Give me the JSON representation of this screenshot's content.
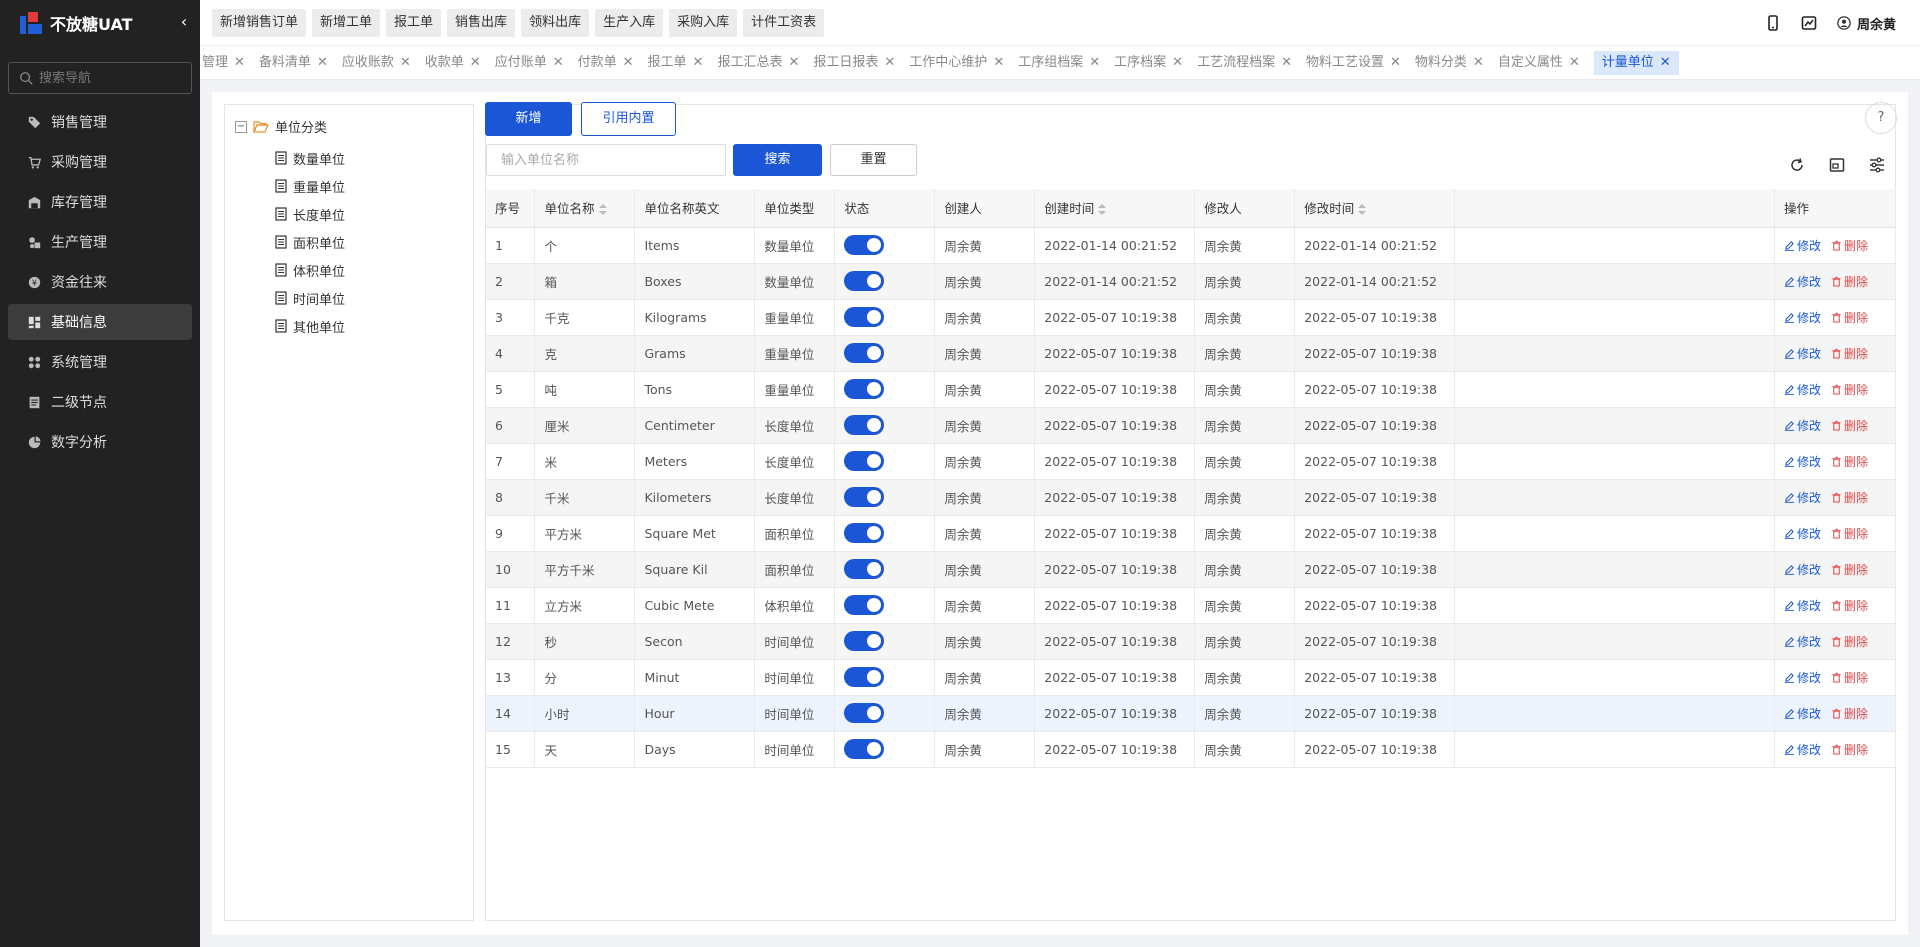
{
  "app": {
    "title": "不放糖UAT"
  },
  "sidebar": {
    "search_placeholder": "搜索导航",
    "items": [
      {
        "label": "销售管理",
        "icon": "tag-icon"
      },
      {
        "label": "采购管理",
        "icon": "cart-icon"
      },
      {
        "label": "库存管理",
        "icon": "warehouse-icon"
      },
      {
        "label": "生产管理",
        "icon": "factory-icon"
      },
      {
        "label": "资金往来",
        "icon": "money-icon"
      },
      {
        "label": "基础信息",
        "icon": "dashboard-icon"
      },
      {
        "label": "系统管理",
        "icon": "apps-icon"
      },
      {
        "label": "二级节点",
        "icon": "list-icon"
      },
      {
        "label": "数字分析",
        "icon": "pie-icon"
      }
    ]
  },
  "topbar": {
    "quick_actions": [
      "新增销售订单",
      "新增工单",
      "报工单",
      "销售出库",
      "领料出库",
      "生产入库",
      "采购入库",
      "计件工资表"
    ],
    "user_name": "周余黄"
  },
  "tabs": [
    "管理",
    "备料清单",
    "应收账款",
    "收款单",
    "应付账单",
    "付款单",
    "报工单",
    "报工汇总表",
    "报工日报表",
    "工作中心维护",
    "工序组档案",
    "工序档案",
    "工艺流程档案",
    "物料工艺设置",
    "物料分类",
    "自定义属性",
    "计量单位"
  ],
  "tree": {
    "root": "单位分类",
    "children": [
      "数量单位",
      "重量单位",
      "长度单位",
      "面积单位",
      "体积单位",
      "时间单位",
      "其他单位"
    ]
  },
  "toolbar": {
    "add_label": "新增",
    "import_label": "引用内置",
    "search_placeholder": "输入单位名称",
    "search_label": "搜索",
    "reset_label": "重置",
    "help_label": "?"
  },
  "table": {
    "headers": [
      "序号",
      "单位名称",
      "单位名称英文",
      "单位类型",
      "状态",
      "创建人",
      "创建时间",
      "修改人",
      "修改时间",
      "",
      "操作"
    ],
    "edit_label": "修改",
    "delete_label": "删除",
    "rows": [
      [
        "1",
        "个",
        "Items",
        "数量单位",
        "周余黄",
        "2022-01-14 00:21:52",
        "周余黄",
        "2022-01-14 00:21:52"
      ],
      [
        "2",
        "箱",
        "Boxes",
        "数量单位",
        "周余黄",
        "2022-01-14 00:21:52",
        "周余黄",
        "2022-01-14 00:21:52"
      ],
      [
        "3",
        "千克",
        "Kilograms",
        "重量单位",
        "周余黄",
        "2022-05-07 10:19:38",
        "周余黄",
        "2022-05-07 10:19:38"
      ],
      [
        "4",
        "克",
        "Grams",
        "重量单位",
        "周余黄",
        "2022-05-07 10:19:38",
        "周余黄",
        "2022-05-07 10:19:38"
      ],
      [
        "5",
        "吨",
        "Tons",
        "重量单位",
        "周余黄",
        "2022-05-07 10:19:38",
        "周余黄",
        "2022-05-07 10:19:38"
      ],
      [
        "6",
        "厘米",
        "Centimeter",
        "长度单位",
        "周余黄",
        "2022-05-07 10:19:38",
        "周余黄",
        "2022-05-07 10:19:38"
      ],
      [
        "7",
        "米",
        "Meters",
        "长度单位",
        "周余黄",
        "2022-05-07 10:19:38",
        "周余黄",
        "2022-05-07 10:19:38"
      ],
      [
        "8",
        "千米",
        "Kilometers",
        "长度单位",
        "周余黄",
        "2022-05-07 10:19:38",
        "周余黄",
        "2022-05-07 10:19:38"
      ],
      [
        "9",
        "平方米",
        "Square Met",
        "面积单位",
        "周余黄",
        "2022-05-07 10:19:38",
        "周余黄",
        "2022-05-07 10:19:38"
      ],
      [
        "10",
        "平方千米",
        "Square Kil",
        "面积单位",
        "周余黄",
        "2022-05-07 10:19:38",
        "周余黄",
        "2022-05-07 10:19:38"
      ],
      [
        "11",
        "立方米",
        "Cubic Mete",
        "体积单位",
        "周余黄",
        "2022-05-07 10:19:38",
        "周余黄",
        "2022-05-07 10:19:38"
      ],
      [
        "12",
        "秒",
        "Secon",
        "时间单位",
        "周余黄",
        "2022-05-07 10:19:38",
        "周余黄",
        "2022-05-07 10:19:38"
      ],
      [
        "13",
        "分",
        "Minut",
        "时间单位",
        "周余黄",
        "2022-05-07 10:19:38",
        "周余黄",
        "2022-05-07 10:19:38"
      ],
      [
        "14",
        "小时",
        "Hour",
        "时间单位",
        "周余黄",
        "2022-05-07 10:19:38",
        "周余黄",
        "2022-05-07 10:19:38"
      ],
      [
        "15",
        "天",
        "Days",
        "时间单位",
        "周余黄",
        "2022-05-07 10:19:38",
        "周余黄",
        "2022-05-07 10:19:38"
      ]
    ]
  },
  "colors": {
    "primary": "#1a56d6",
    "danger": "#e04848",
    "sidebar_bg": "#222222"
  }
}
